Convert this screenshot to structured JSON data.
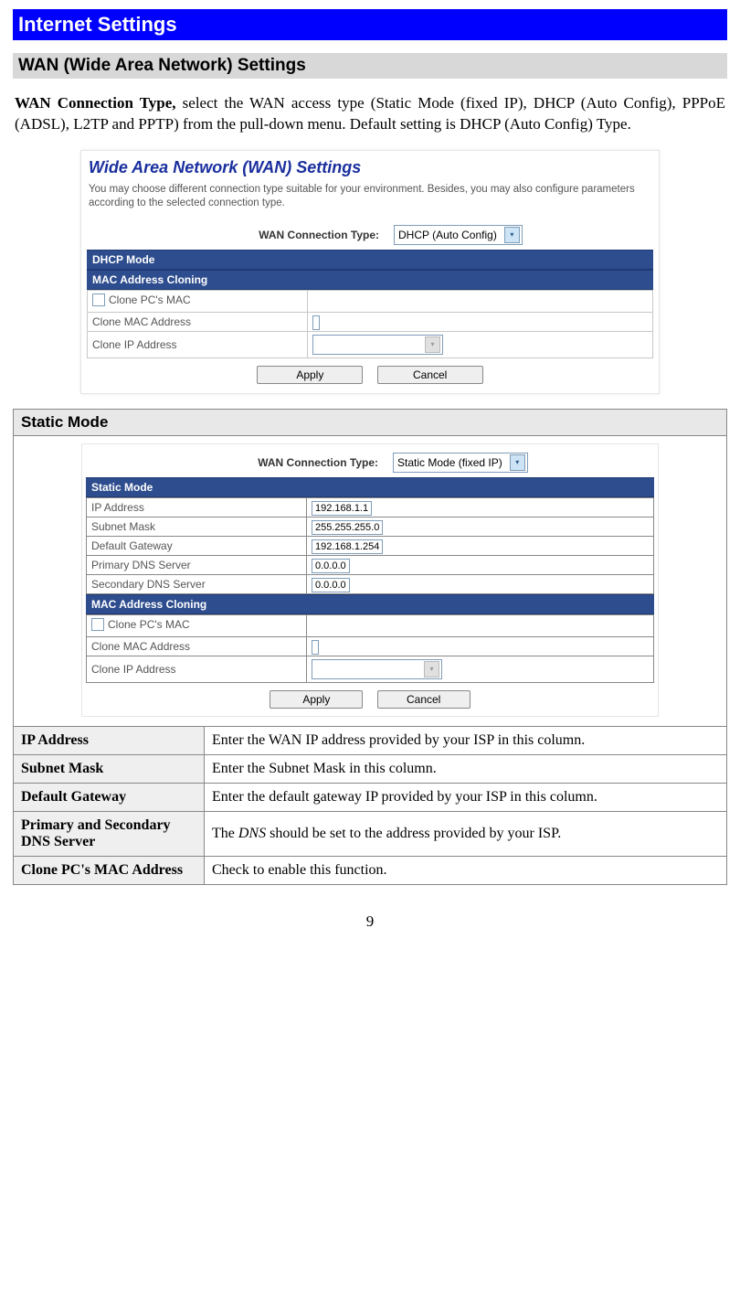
{
  "page": {
    "title": "Internet Settings",
    "subtitle": "WAN (Wide Area Network) Settings",
    "intro_lead": "WAN Connection Type, ",
    "intro_rest": "select the WAN access type (Static Mode (fixed IP), DHCP (Auto Config), PPPoE (ADSL), L2TP and PPTP) from the pull-down menu. Default setting is DHCP (Auto Config) Type.",
    "page_number": "9"
  },
  "shot1": {
    "heading": "Wide Area Network (WAN) Settings",
    "desc": "You may choose different connection type suitable for your environment. Besides, you may also configure parameters according to the selected connection type.",
    "conn_type_label": "WAN Connection Type:",
    "conn_type_value": "DHCP (Auto Config)",
    "bar_dhcp": "DHCP Mode",
    "bar_mac": "MAC Address Cloning",
    "clone_pc_mac": "Clone PC's MAC",
    "clone_mac_addr": "Clone MAC Address",
    "clone_ip_addr": "Clone IP Address",
    "apply": "Apply",
    "cancel": "Cancel"
  },
  "static_section": {
    "header": "Static Mode"
  },
  "shot2": {
    "conn_type_label": "WAN Connection Type:",
    "conn_type_value": "Static Mode (fixed IP)",
    "bar_static": "Static Mode",
    "ip_address_label": "IP Address",
    "ip_address_value": "192.168.1.1",
    "subnet_label": "Subnet Mask",
    "subnet_value": "255.255.255.0",
    "gateway_label": "Default Gateway",
    "gateway_value": "192.168.1.254",
    "pdns_label": "Primary DNS Server",
    "pdns_value": "0.0.0.0",
    "sdns_label": "Secondary DNS Server",
    "sdns_value": "0.0.0.0",
    "bar_mac": "MAC Address Cloning",
    "clone_pc_mac": "Clone PC's MAC",
    "clone_mac_addr": "Clone MAC Address",
    "clone_ip_addr": "Clone IP Address",
    "apply": "Apply",
    "cancel": "Cancel"
  },
  "desc_rows": [
    {
      "key": "IP Address",
      "val": "Enter the WAN IP address provided by your ISP in this column."
    },
    {
      "key": "Subnet Mask",
      "val": "Enter the Subnet Mask in this column."
    },
    {
      "key": "Default Gateway",
      "val": "Enter the default gateway IP provided by your ISP in this column."
    },
    {
      "key": "Primary and Secondary DNS Server",
      "val_pre": "The ",
      "val_em": "DNS",
      "val_post": " should be set to the address provided by your ISP."
    },
    {
      "key": "Clone PC's MAC Address",
      "val": "Check to enable this function."
    }
  ]
}
